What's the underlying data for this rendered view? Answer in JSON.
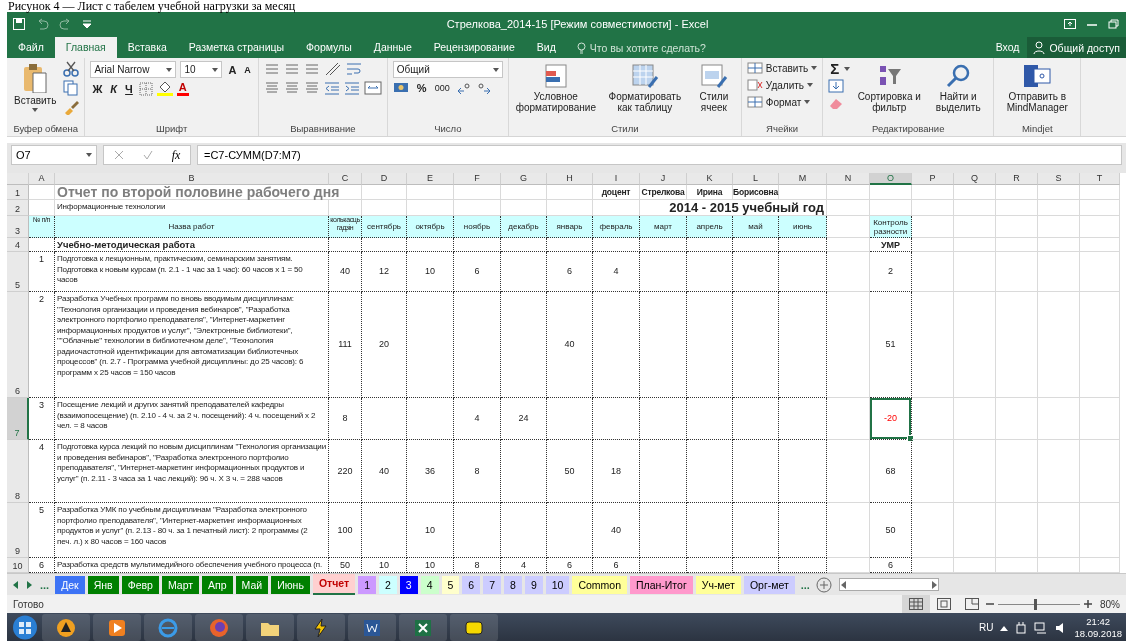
{
  "caption": "Рисунок 4 — Лист с табелем учебной нагрузки за месяц",
  "title_bar": {
    "title": "Стрелкова_2014-15  [Режим совместимости] - Excel"
  },
  "ribbon_tabs": [
    {
      "label": "Файл",
      "selected": false
    },
    {
      "label": "Главная",
      "selected": true
    },
    {
      "label": "Вставка",
      "selected": false
    },
    {
      "label": "Разметка страницы",
      "selected": false
    },
    {
      "label": "Формулы",
      "selected": false
    },
    {
      "label": "Данные",
      "selected": false
    },
    {
      "label": "Рецензирование",
      "selected": false
    },
    {
      "label": "Вид",
      "selected": false
    }
  ],
  "tell_me": {
    "placeholder": "Что вы хотите сделать?"
  },
  "account": {
    "sign_in": "Вход",
    "share": "Общий доступ"
  },
  "ribbon": {
    "groups": [
      {
        "kind": "clipboard",
        "label": "Буфер обмена",
        "buttons": [
          "Вставить"
        ]
      },
      {
        "kind": "font",
        "label": "Шрифт",
        "font_name": "Arial Narrow",
        "font_size": "10",
        "grow": "A",
        "shrink": "A",
        "bold": "Ж",
        "italic": "К",
        "underline": "Ч",
        "font_color": "A"
      },
      {
        "kind": "alignment",
        "label": "Выравнивание"
      },
      {
        "kind": "number",
        "label": "Число",
        "format": "Общий",
        "percent": "%",
        "thousands": "000"
      },
      {
        "kind": "styles",
        "label": "Стили",
        "buttons": [
          "Условное форматирование",
          "Форматировать как таблицу",
          "Стили ячеек"
        ]
      },
      {
        "kind": "cells",
        "label": "Ячейки",
        "buttons": [
          "Вставить",
          "Удалить",
          "Формат"
        ]
      },
      {
        "kind": "editing",
        "label": "Редактирование",
        "autosum": "Σ",
        "buttons": [
          "Сортировка и фильтр",
          "Найти и выделить"
        ]
      },
      {
        "kind": "mindjet",
        "label": "Mindjet",
        "buttons": [
          "Отправить в MindManager"
        ]
      }
    ]
  },
  "formula_bar": {
    "name_box": "O7",
    "fx": "fx",
    "formula": "=C7-СУММ(D7:M7)"
  },
  "sheet": {
    "columns": [
      {
        "letter": "A",
        "selected": false,
        "in_table": true
      },
      {
        "letter": "B",
        "selected": false,
        "in_table": true
      },
      {
        "letter": "C",
        "selected": false,
        "in_table": true
      },
      {
        "letter": "D",
        "selected": false,
        "in_table": true
      },
      {
        "letter": "E",
        "selected": false,
        "in_table": true
      },
      {
        "letter": "F",
        "selected": false,
        "in_table": true
      },
      {
        "letter": "G",
        "selected": false,
        "in_table": true
      },
      {
        "letter": "H",
        "selected": false,
        "in_table": true
      },
      {
        "letter": "I",
        "selected": false,
        "in_table": true
      },
      {
        "letter": "J",
        "selected": false,
        "in_table": true
      },
      {
        "letter": "K",
        "selected": false,
        "in_table": true
      },
      {
        "letter": "L",
        "selected": false,
        "in_table": true
      },
      {
        "letter": "M",
        "selected": false,
        "in_table": true
      },
      {
        "letter": "N",
        "selected": false,
        "in_table": false
      },
      {
        "letter": "O",
        "selected": true,
        "in_table": true
      },
      {
        "letter": "P",
        "selected": false,
        "in_table": false
      },
      {
        "letter": "Q",
        "selected": false,
        "in_table": false
      },
      {
        "letter": "R",
        "selected": false,
        "in_table": false
      },
      {
        "letter": "S",
        "selected": false,
        "in_table": false
      },
      {
        "letter": "T",
        "selected": false,
        "in_table": false
      }
    ],
    "rows": [
      {
        "number": "1",
        "selected": false,
        "kind": "plain",
        "cells": [
          null,
          {
            "kind": "title",
            "text": "Отчет по второй половине рабочего дня"
          },
          null,
          null,
          null,
          null,
          null,
          null,
          {
            "kind": "bold",
            "text": "доцент"
          },
          {
            "kind": "bold",
            "text": "Стрелкова"
          },
          {
            "kind": "bold",
            "text": "Ирина"
          },
          {
            "kind": "bold",
            "text": "Борисовна"
          },
          null,
          null,
          null,
          null,
          null,
          null,
          null,
          null
        ]
      },
      {
        "number": "2",
        "selected": false,
        "kind": "plain",
        "cells": [
          null,
          {
            "kind": "text",
            "text": "Информационные технологии"
          },
          null,
          null,
          null,
          null,
          null,
          null,
          null,
          {
            "kind": "year",
            "text": "2014 - 2015 учебный год"
          },
          null,
          null,
          null,
          null,
          null,
          null,
          null,
          null,
          null,
          null
        ]
      },
      {
        "number": "3",
        "selected": false,
        "kind": "table",
        "cells": [
          {
            "kind": "header",
            "text": "№ п/п"
          },
          {
            "kind": "header",
            "text": "Назва работ"
          },
          {
            "kind": "header",
            "text": "колькасць гадзін"
          },
          {
            "kind": "header",
            "text": "сентябрь"
          },
          {
            "kind": "header",
            "text": "октябрь"
          },
          {
            "kind": "header",
            "text": "ноябрь"
          },
          {
            "kind": "header",
            "text": "декабрь"
          },
          {
            "kind": "header",
            "text": "январь"
          },
          {
            "kind": "header",
            "text": "февраль"
          },
          {
            "kind": "header",
            "text": "март"
          },
          {
            "kind": "header",
            "text": "апрель"
          },
          {
            "kind": "header",
            "text": "май"
          },
          {
            "kind": "header",
            "text": "июнь"
          },
          null,
          {
            "kind": "header",
            "text": "Контроль разности"
          },
          null,
          null,
          null,
          null,
          null
        ]
      },
      {
        "number": "4",
        "selected": false,
        "kind": "table",
        "cells": [
          null,
          {
            "kind": "section",
            "text": "Учебно-методическая работа"
          },
          null,
          null,
          null,
          null,
          null,
          null,
          null,
          null,
          null,
          null,
          null,
          null,
          {
            "kind": "section_center",
            "text": "УМР"
          },
          null,
          null,
          null,
          null,
          null
        ]
      },
      {
        "number": "5",
        "selected": false,
        "kind": "table",
        "cells": [
          {
            "kind": "index",
            "text": "1"
          },
          {
            "kind": "text",
            "text": "Подготовка к лекционным, практическим, семинарским занятиям.\nПодготовка к новым курсам (п. 2.1 - 1 час за 1 час): 60 часов х 1 = 50\nчасов"
          },
          {
            "kind": "number",
            "text": "40"
          },
          {
            "kind": "number",
            "text": "12"
          },
          {
            "kind": "number",
            "text": "10"
          },
          {
            "kind": "number",
            "text": "6"
          },
          null,
          {
            "kind": "number",
            "text": "6"
          },
          {
            "kind": "number",
            "text": "4"
          },
          null,
          null,
          null,
          null,
          null,
          {
            "kind": "number",
            "text": "2"
          },
          null,
          null,
          null,
          null,
          null
        ]
      },
      {
        "number": "6",
        "selected": false,
        "kind": "table",
        "cells": [
          {
            "kind": "index",
            "text": "2"
          },
          {
            "kind": "text",
            "text": "Разработка Учебных программ по вновь вводимым дисциплинам:\n\"Технология организации и проведения вебинаров\", \"Разработка\nэлектронного портфолио преподавателя\", \"Интернет-маркетинг\nинформационных продуктов и услуг\", \"Электронные библиотеки\",\n\"\"Облачные\" технологии в библиотечном деле\", \"Технология\nрадиочастотной идентификации для автоматизации библиотечных\nпроцессов\" (п. 2.7 - Программа учебной дисциплины: до 25 часов): 6\nпрограмм х 25 часов = 150 часов"
          },
          {
            "kind": "number",
            "text": "111"
          },
          {
            "kind": "number",
            "text": "20"
          },
          null,
          null,
          null,
          {
            "kind": "number",
            "text": "40"
          },
          null,
          null,
          null,
          null,
          null,
          null,
          {
            "kind": "number",
            "text": "51"
          },
          null,
          null,
          null,
          null,
          null
        ]
      },
      {
        "number": "7",
        "selected": true,
        "kind": "table",
        "cells": [
          {
            "kind": "index",
            "text": "3"
          },
          {
            "kind": "text",
            "text": "Посещение лекций и других занятий преподавателей кафедры\n(взаимопосещение) (п. 2.10 - 4 ч. за 2 ч. посещений):  4 ч. посещений х 2\nчел. = 8 часов"
          },
          {
            "kind": "number",
            "text": "8"
          },
          null,
          null,
          {
            "kind": "number",
            "text": "4"
          },
          {
            "kind": "number",
            "text": "24"
          },
          null,
          null,
          null,
          null,
          null,
          null,
          null,
          {
            "kind": "negative",
            "text": "-20"
          },
          null,
          null,
          null,
          null,
          null
        ]
      },
      {
        "number": "8",
        "selected": false,
        "kind": "table",
        "cells": [
          {
            "kind": "index",
            "text": "4"
          },
          {
            "kind": "text",
            "text": "Подготовка курса лекций по новым дисциплинам \"Технология организации\nи проведения вебинаров\", \"Разработка электронного портфолио\nпреподавателя\", \"Интернет-маркетинг информационных продуктов и\nуслуг\" (п. 2.11 - 3 часа за 1 час лекций): 96 ч. Х 3 ч. = 288 часов"
          },
          {
            "kind": "number",
            "text": "220"
          },
          {
            "kind": "number",
            "text": "40"
          },
          {
            "kind": "number",
            "text": "36"
          },
          {
            "kind": "number",
            "text": "8"
          },
          null,
          {
            "kind": "number",
            "text": "50"
          },
          {
            "kind": "number",
            "text": "18"
          },
          null,
          null,
          null,
          null,
          null,
          {
            "kind": "number",
            "text": "68"
          },
          null,
          null,
          null,
          null,
          null
        ]
      },
      {
        "number": "9",
        "selected": false,
        "kind": "table",
        "cells": [
          {
            "kind": "index",
            "text": "5"
          },
          {
            "kind": "text",
            "text": "Разработка УМК по учебным дисциплинам \"Разработка электронного\nпортфолио преподавателя\", \"Интернет-маркетинг информационных\nпродуктов и услуг\" (п. 2.13 - 80 ч. за 1 печатный лист): 2 программы (2\nпеч. л.) х 80 часов = 160 часов"
          },
          {
            "kind": "number",
            "text": "100"
          },
          null,
          {
            "kind": "number",
            "text": "10"
          },
          null,
          null,
          null,
          {
            "kind": "number",
            "text": "40"
          },
          null,
          null,
          null,
          null,
          null,
          {
            "kind": "number",
            "text": "50"
          },
          null,
          null,
          null,
          null,
          null
        ]
      },
      {
        "number": "10",
        "selected": false,
        "kind": "table",
        "cells": [
          {
            "kind": "index",
            "text": "6"
          },
          {
            "kind": "text",
            "text": "Разработка средств мультимедийного обеспечения учебного процесса (п."
          },
          {
            "kind": "number",
            "text": "50"
          },
          {
            "kind": "number",
            "text": "10"
          },
          {
            "kind": "number",
            "text": "10"
          },
          {
            "kind": "number",
            "text": "8"
          },
          {
            "kind": "number",
            "text": "4"
          },
          {
            "kind": "number",
            "text": "6"
          },
          {
            "kind": "number",
            "text": "6"
          },
          null,
          null,
          null,
          null,
          null,
          {
            "kind": "number",
            "text": "6"
          },
          null,
          null,
          null,
          null,
          null
        ]
      }
    ]
  },
  "sheet_tabs": {
    "more": "...",
    "tabs": [
      {
        "label": "Дек",
        "color": "#3d73f5",
        "selected": false
      },
      {
        "label": "Янв",
        "color": "#008000",
        "selected": false
      },
      {
        "label": "Февр",
        "color": "#008000",
        "selected": false
      },
      {
        "label": "Март",
        "color": "#008000",
        "selected": false
      },
      {
        "label": "Апр",
        "color": "#008000",
        "selected": false
      },
      {
        "label": "Май",
        "color": "#008000",
        "selected": false
      },
      {
        "label": "Июнь",
        "color": "#008000",
        "selected": false
      },
      {
        "label": "Отчет",
        "color": "#ffd0d0",
        "selected": true
      },
      {
        "label": "1",
        "color": "#cc99ff",
        "selected": false
      },
      {
        "label": "2",
        "color": "#ccffff",
        "selected": false
      },
      {
        "label": "3",
        "color": "#0000ff",
        "selected": false
      },
      {
        "label": "4",
        "color": "#ccffcc",
        "selected": false
      },
      {
        "label": "5",
        "color": "#ffffcc",
        "selected": false
      },
      {
        "label": "6",
        "color": "#ccccff",
        "selected": false
      },
      {
        "label": "7",
        "color": "#ccccff",
        "selected": false
      },
      {
        "label": "8",
        "color": "#ccccff",
        "selected": false
      },
      {
        "label": "9",
        "color": "#ccccff",
        "selected": false
      },
      {
        "label": "10",
        "color": "#ccccff",
        "selected": false
      },
      {
        "label": "Common",
        "color": "#ffff99",
        "selected": false
      },
      {
        "label": "План-Итог",
        "color": "#ff99cc",
        "selected": false
      },
      {
        "label": "Уч-мет",
        "color": "#ffff99",
        "selected": false
      },
      {
        "label": "Орг-мет",
        "color": "#ccccff",
        "selected": false
      }
    ],
    "more_right": "..."
  },
  "status_bar": {
    "status": "Готово",
    "zoom": {
      "level": 0.45,
      "reading": "80%"
    }
  },
  "taskbar": {
    "language": "RU",
    "time": "21:42",
    "date": "18.09.2018"
  }
}
